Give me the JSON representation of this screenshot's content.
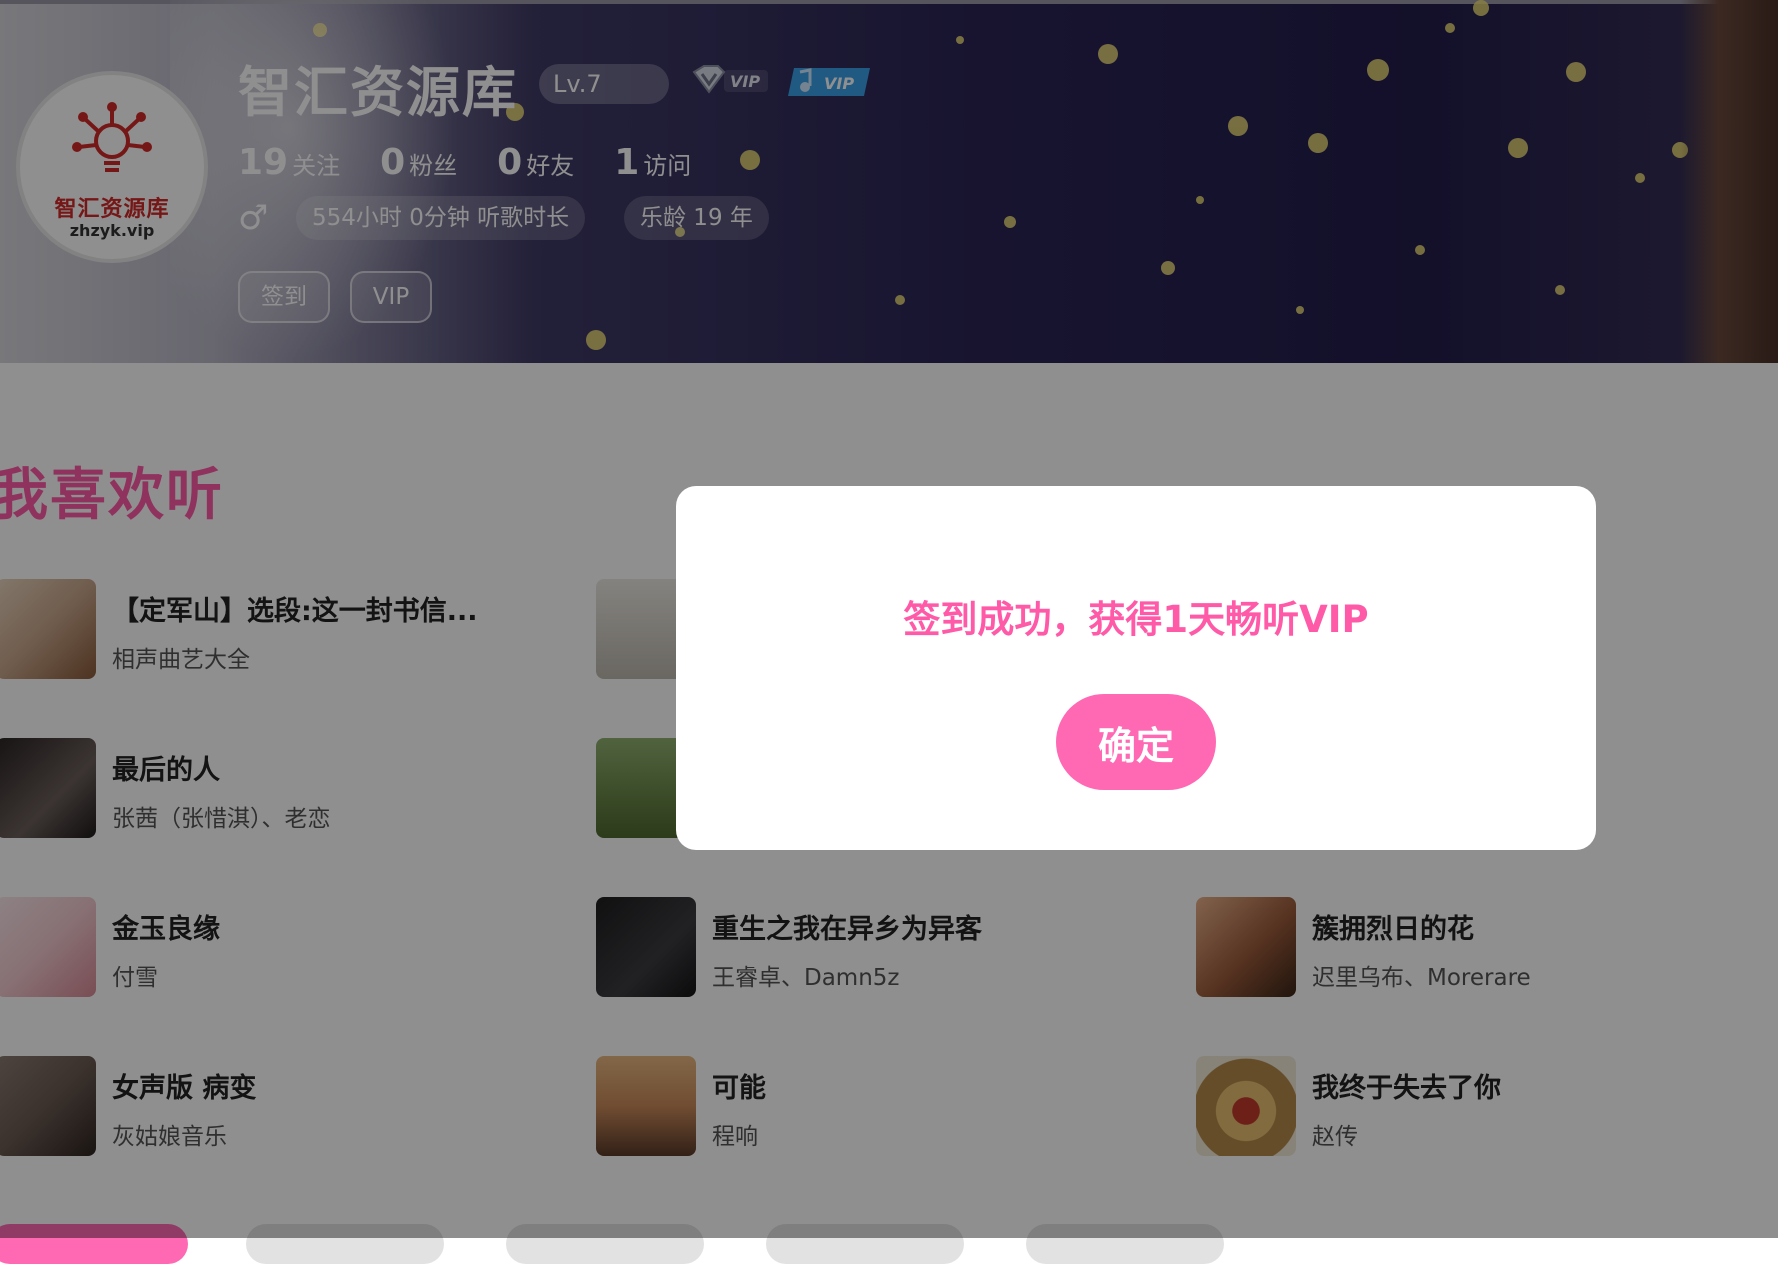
{
  "profile": {
    "username": "智汇资源库",
    "level": "Lv.7",
    "vip_badge_1": "VIP",
    "vip_badge_2": "VIP",
    "avatar_title": "智汇资源库",
    "avatar_domain": "zhzyk.vip",
    "stats": [
      {
        "num": "19",
        "label": "关注"
      },
      {
        "num": "0",
        "label": "粉丝"
      },
      {
        "num": "0",
        "label": "好友"
      },
      {
        "num": "1",
        "label": "访问"
      }
    ],
    "gender_icon": "♂",
    "listen_time": "554小时 0分钟 听歌时长",
    "music_age": "乐龄 19 年",
    "checkin_label": "签到",
    "vip_label": "VIP"
  },
  "section": {
    "title": "我喜欢听"
  },
  "songs": [
    {
      "title": "【定军山】选段:这一封书信...",
      "artist": "相声曲艺大全",
      "cover": "#c7a58a"
    },
    {
      "title": "",
      "artist": "",
      "cover": "#d4cfc6"
    },
    {
      "title": "最后的人",
      "artist": "张茜（张惜淇）、老恋",
      "cover": "#3a3434"
    },
    {
      "title": "",
      "artist": "",
      "cover": "#5f7a3a"
    },
    {
      "title": "金玉良缘",
      "artist": "付雪",
      "cover": "#f2c9cf"
    },
    {
      "title": "重生之我在异乡为异客",
      "artist": "王睿卓、Damn5z",
      "cover": "#2e2e30"
    },
    {
      "title": "簇拥烈日的花",
      "artist": "迟里乌布、Morerare",
      "cover": "#9a5a3a"
    },
    {
      "title": "女声版 病变",
      "artist": "灰姑娘音乐",
      "cover": "#6a5a52"
    },
    {
      "title": "可能",
      "artist": "程响",
      "cover": "#c98a5a"
    },
    {
      "title": "我终于失去了你",
      "artist": "赵传",
      "cover": "#b58a4a"
    }
  ],
  "dialog": {
    "message": "签到成功，获得1天畅听VIP",
    "ok_label": "确定"
  },
  "colors": {
    "accent_pink": "#ff69b4",
    "title_pink": "#ff5aa8"
  }
}
